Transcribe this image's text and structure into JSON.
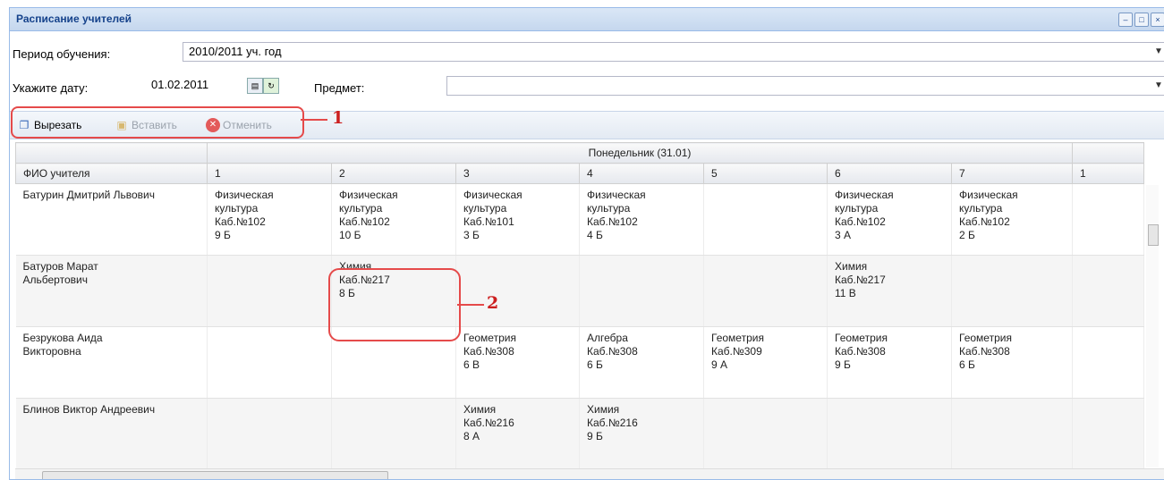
{
  "window": {
    "title": "Расписание учителей",
    "controls": [
      "–",
      "□",
      "×"
    ]
  },
  "filters": {
    "period_label": "Период обучения:",
    "period_value": "2010/2011 уч. год",
    "date_label": "Укажите дату:",
    "date_value": "01.02.2011",
    "subject_label": "Предмет:",
    "subject_value": ""
  },
  "toolbar": {
    "cut": "Вырезать",
    "paste": "Вставить",
    "cancel": "Отменить"
  },
  "annotations": {
    "one": "1",
    "two": "2"
  },
  "grid": {
    "group_header": "Понедельник (31.01)",
    "name_header": "ФИО учителя",
    "lesson_headers": [
      "1",
      "2",
      "3",
      "4",
      "5",
      "6",
      "7",
      "1"
    ],
    "rows": [
      {
        "name": "Батурин Дмитрий Львович",
        "cells": [
          "Физическая\nкультура\nКаб.№102\n9 Б",
          "Физическая\nкультура\nКаб.№102\n10 Б",
          "Физическая\nкультура\nКаб.№101\n3 Б",
          "Физическая\nкультура\nКаб.№102\n4 Б",
          "",
          "Физическая\nкультура\nКаб.№102\n3 А",
          "Физическая\nкультура\nКаб.№102\n2 Б",
          ""
        ]
      },
      {
        "name": "Батуров Марат\nАльбертович",
        "cells": [
          "",
          "Химия\nКаб.№217\n8 Б",
          "",
          "",
          "",
          "Химия\nКаб.№217\n11 В",
          "",
          ""
        ]
      },
      {
        "name": "Безрукова Аида\nВикторовна",
        "cells": [
          "",
          "",
          "Геометрия\nКаб.№308\n6 В",
          "Алгебра\nКаб.№308\n6 Б",
          "Геометрия\nКаб.№309\n9 А",
          "Геометрия\nКаб.№308\n9 Б",
          "Геометрия\nКаб.№308\n6 Б",
          ""
        ]
      },
      {
        "name": "Блинов Виктор Андреевич",
        "cells": [
          "",
          "",
          "Химия\nКаб.№216\n8 А",
          "Химия\nКаб.№216\n9 Б",
          "",
          "",
          "",
          ""
        ]
      }
    ]
  },
  "colors": {
    "accent": "#15428b",
    "annotation": "#e54a4a"
  }
}
